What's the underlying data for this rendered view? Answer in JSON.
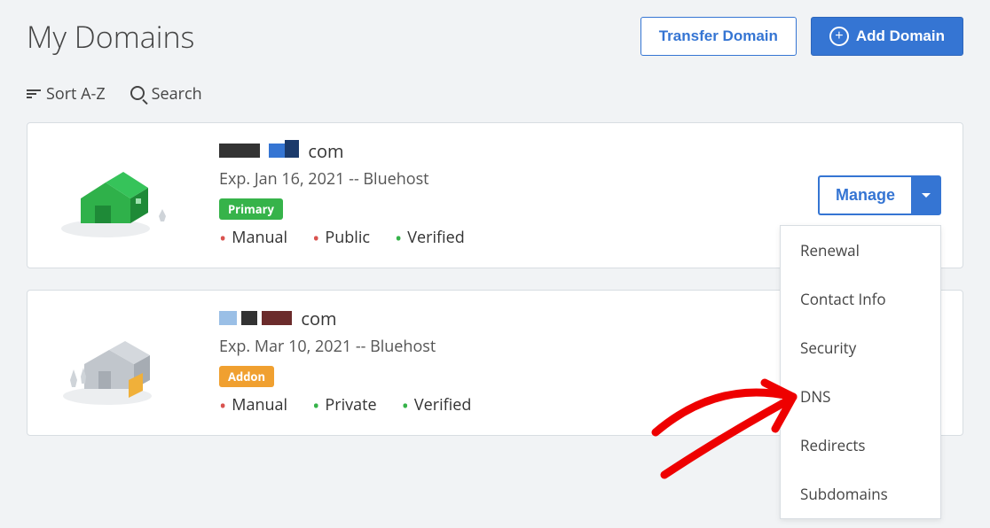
{
  "header": {
    "title": "My Domains",
    "transfer_label": "Transfer Domain",
    "add_label": "Add Domain"
  },
  "toolbar": {
    "sort_label": "Sort A-Z",
    "search_label": "Search"
  },
  "domains": [
    {
      "tld": "com",
      "expiry_line": "Exp. Jan 16, 2021 -- Bluehost",
      "badge": {
        "type": "primary",
        "label": "Primary"
      },
      "status": [
        {
          "dot": "red",
          "label": "Manual"
        },
        {
          "dot": "red",
          "label": "Public"
        },
        {
          "dot": "green",
          "label": "Verified"
        }
      ],
      "manage_label": "Manage",
      "illustration": "house-green"
    },
    {
      "tld": "com",
      "expiry_line": "Exp. Mar 10, 2021 -- Bluehost",
      "badge": {
        "type": "addon",
        "label": "Addon"
      },
      "status": [
        {
          "dot": "red",
          "label": "Manual"
        },
        {
          "dot": "green",
          "label": "Private"
        },
        {
          "dot": "green",
          "label": "Verified"
        }
      ],
      "manage_label": "Manage",
      "illustration": "house-grey"
    }
  ],
  "manage_menu": [
    "Renewal",
    "Contact Info",
    "Security",
    "DNS",
    "Redirects",
    "Subdomains"
  ]
}
